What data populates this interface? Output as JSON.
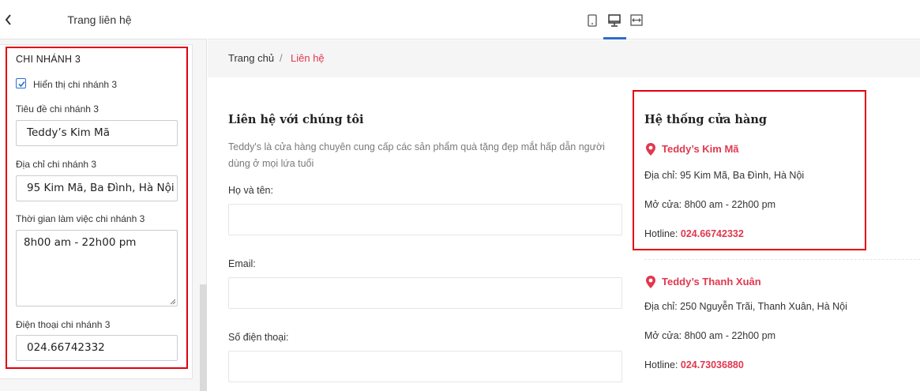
{
  "sidebar": {
    "title": "Trang liên hệ",
    "section_title": "CHI NHÁNH 3",
    "show_branch_label": "Hiển thị chi nhánh 3",
    "show_branch_checked": true,
    "fields": {
      "title_label": "Tiêu đề chi nhánh 3",
      "title_value": "Teddy’s Kim Mã",
      "address_label": "Địa chỉ chi nhánh 3",
      "address_value": "95 Kim Mã, Ba Đình, Hà Nội",
      "hours_label": "Thời gian làm việc chi nhánh 3",
      "hours_value": "8h00 am - 22h00 pm",
      "phone_label": "Điện thoại chi nhánh 3",
      "phone_value": "024.66742332"
    }
  },
  "toolbar": {
    "devices": [
      "mobile-icon",
      "desktop-icon",
      "fullwidth-icon"
    ],
    "active_device": "desktop-icon",
    "accent": "#2c6ecb"
  },
  "preview": {
    "breadcrumb": {
      "home": "Trang chủ",
      "separator": "/",
      "current": "Liên hệ"
    },
    "contact": {
      "heading": "Liên hệ với chúng tôi",
      "description": "Teddy's là cửa hàng chuyên cung cấp các sản phẩm quà tặng đẹp mắt hấp dẫn người dùng ở mọi lứa tuổi",
      "name_label": "Họ và tên:",
      "email_label": "Email:",
      "phone_label": "Số điện thoại:"
    },
    "stores": {
      "heading": "Hệ thống cửa hàng",
      "branches": [
        {
          "name": "Teddy’s Kim Mã",
          "address_label": "Địa chỉ:",
          "address": "95 Kim Mã, Ba Đình, Hà Nội",
          "hours_label": "Mở cửa:",
          "hours": "8h00 am - 22h00 pm",
          "hotline_label": "Hotline:",
          "hotline": "024.66742332"
        },
        {
          "name": "Teddy’s Thanh Xuân",
          "address_label": "Địa chỉ:",
          "address": "250 Nguyễn Trãi, Thanh Xuân, Hà Nội",
          "hours_label": "Mở cửa:",
          "hours": "8h00 am - 22h00 pm",
          "hotline_label": "Hotline:",
          "hotline": "024.73036880"
        }
      ]
    },
    "accent_color": "#e0384e",
    "highlight_color": "#e3000f"
  }
}
